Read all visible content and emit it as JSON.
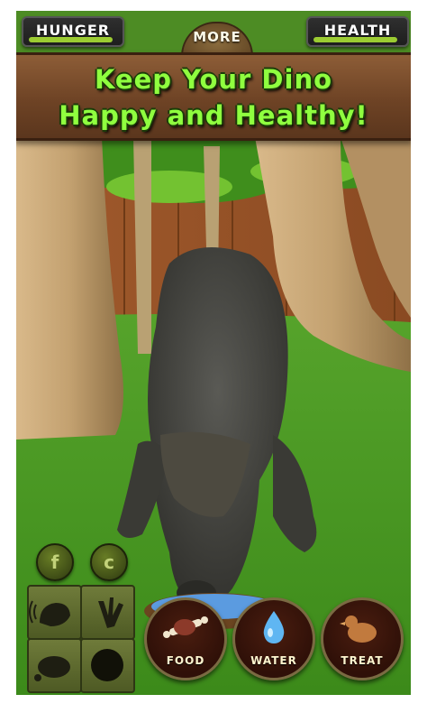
{
  "hud": {
    "hunger_label": "HUNGER",
    "health_label": "HEALTH",
    "more_label": "MORE",
    "hunger_level_pct": 95,
    "health_level_pct": 95
  },
  "banner": {
    "line1": "Keep Your Dino",
    "line2": "Happy and Healthy!"
  },
  "controls": {
    "round_buttons": [
      {
        "glyph": "f",
        "icon": "facebook-icon"
      },
      {
        "glyph": "c",
        "icon": "camera-icon"
      }
    ],
    "tiles": [
      "roar-icon",
      "footprint-icon",
      "meat-icon",
      "shadow-icon"
    ]
  },
  "actions": [
    {
      "label": "FOOD",
      "icon": "bone-meat-icon"
    },
    {
      "label": "WATER",
      "icon": "water-drop-icon"
    },
    {
      "label": "TREAT",
      "icon": "treat-bird-icon"
    }
  ],
  "colors": {
    "banner_text": "#8fff3f",
    "bar_fill": "#9ccc32",
    "water_bowl": "#5b9be0"
  }
}
